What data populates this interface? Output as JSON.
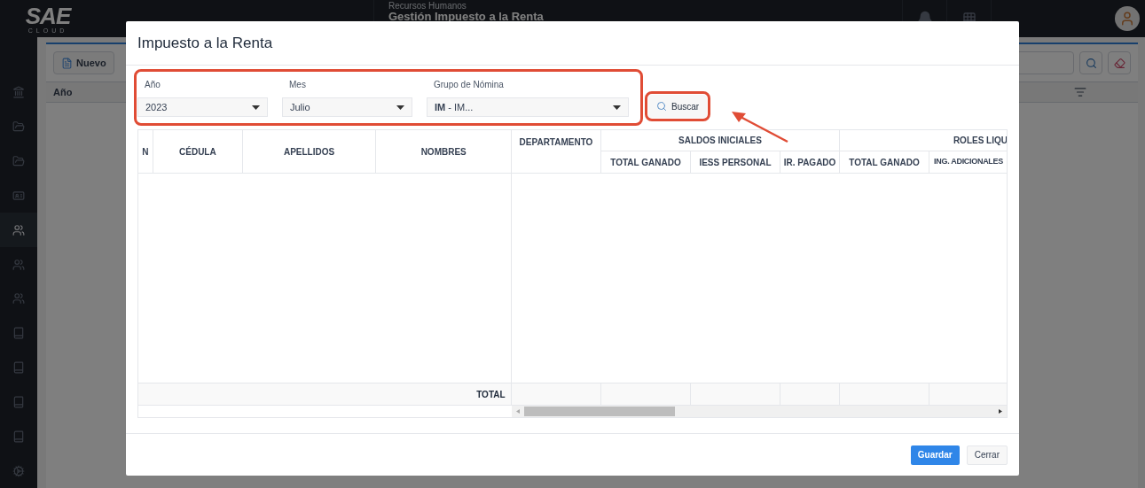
{
  "app": {
    "logo": {
      "mark": "SAE",
      "sub": "CLOUD"
    },
    "breadcrumb": "Recursos Humanos",
    "page_title": "Gestión Impuesto a la Renta",
    "sidebar": [
      {
        "kind": "bank",
        "selected": false
      },
      {
        "kind": "folder",
        "selected": false
      },
      {
        "kind": "folder",
        "selected": false
      },
      {
        "kind": "card",
        "selected": false
      },
      {
        "kind": "users",
        "selected": true
      },
      {
        "kind": "users",
        "selected": false
      },
      {
        "kind": "users",
        "selected": false
      },
      {
        "kind": "book",
        "selected": false
      },
      {
        "kind": "book",
        "selected": false
      },
      {
        "kind": "book",
        "selected": false
      },
      {
        "kind": "book",
        "selected": false
      },
      {
        "kind": "gears",
        "selected": false
      }
    ],
    "toolbar": {
      "new_button": "Nuevo"
    },
    "grid": {
      "column_1": "Año"
    }
  },
  "modal": {
    "title": "Impuesto a la Renta",
    "filters": [
      {
        "label": "Año",
        "value": "2023"
      },
      {
        "label": "Mes",
        "value": "Julio"
      },
      {
        "label": "Grupo de Nómina",
        "value": "**IM** - IM..."
      }
    ],
    "search_button": "Buscar",
    "table": {
      "frozen_columns": [
        "N",
        "CÉDULA",
        "APELLIDOS",
        "NOMBRES"
      ],
      "columns": [
        {
          "label": "DEPARTAMENTO"
        },
        {
          "group": "SALDOS INICIALES",
          "columns": [
            "TOTAL GANADO",
            "IESS PERSONAL",
            "IR. PAGADO"
          ]
        },
        {
          "group": "ROLES LIQU",
          "columns": [
            "TOTAL GANADO",
            "ING. ADICIONALES"
          ]
        }
      ],
      "total_label": "TOTAL"
    },
    "buttons": [
      "Guardar",
      "Cerrar"
    ]
  }
}
